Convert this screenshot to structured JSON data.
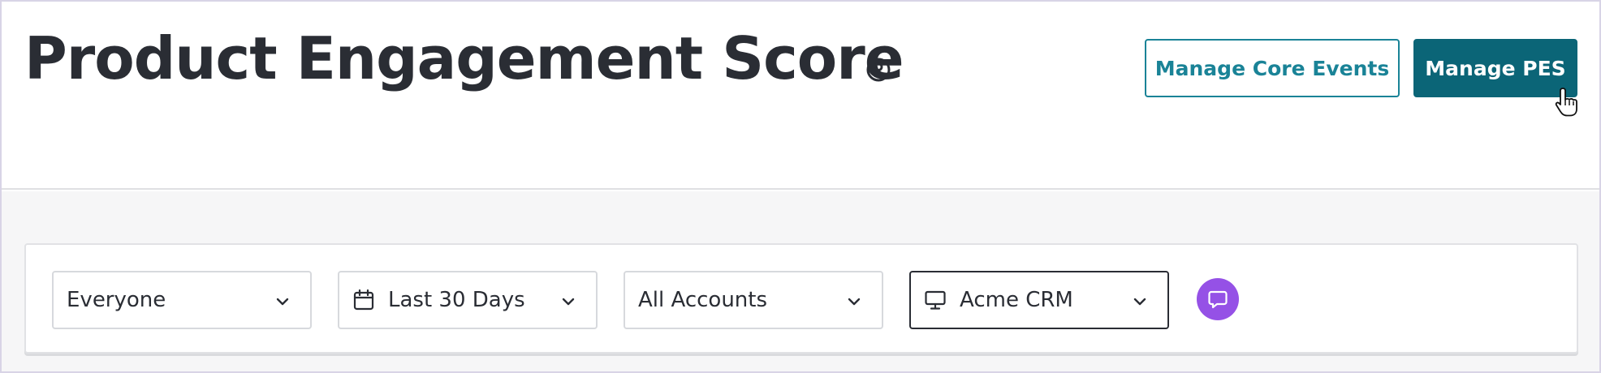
{
  "header": {
    "title": "Product Engagement Score",
    "help_icon": "question-circle-icon",
    "buttons": {
      "manage_core_events": "Manage Core Events",
      "manage_pes": "Manage PES"
    }
  },
  "filters": [
    {
      "label": "Everyone",
      "icon": "chevron-down-icon"
    },
    {
      "label": "Last 30 Days",
      "lead_icon": "calendar-icon",
      "icon": "chevron-down-icon"
    },
    {
      "label": "All Accounts",
      "icon": "chevron-down-icon"
    },
    {
      "label": "Acme CRM",
      "lead_icon": "monitor-icon",
      "icon": "chevron-down-icon",
      "active": true
    }
  ],
  "chat": {
    "icon": "chat-bubble-icon"
  },
  "colors": {
    "primary": "#0b6577",
    "primary_outline": "#1a8397",
    "chat_purple": "#9551e6",
    "title_text": "#2a2d34",
    "content_bg": "#f6f6f7"
  }
}
